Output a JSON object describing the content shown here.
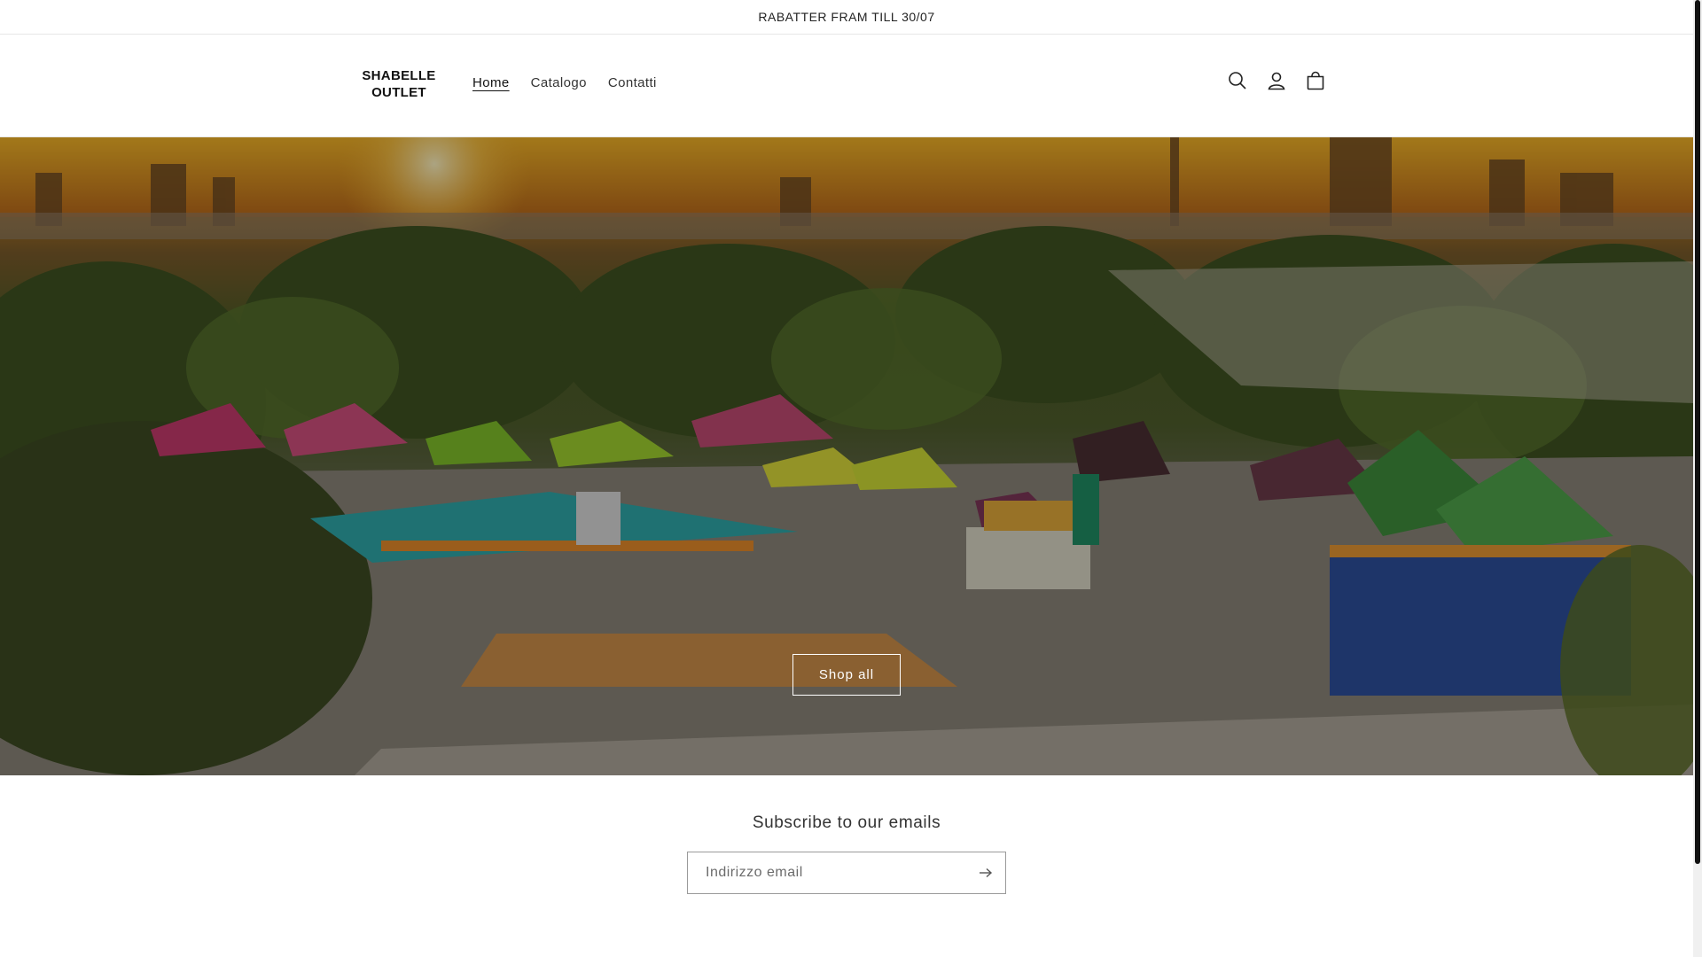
{
  "announcement": {
    "text": "RABATTER FRAM TILL 30/07"
  },
  "header": {
    "logo_line1": "SHABELLE",
    "logo_line2": "OUTLET",
    "nav": [
      {
        "label": "Home",
        "active": true
      },
      {
        "label": "Catalogo",
        "active": false
      },
      {
        "label": "Contatti",
        "active": false
      }
    ],
    "icons": [
      "search-icon",
      "account-icon",
      "cart-icon"
    ]
  },
  "hero": {
    "button_label": "Shop all",
    "overlay_color": "#000000"
  },
  "newsletter": {
    "title": "Subscribe to our emails",
    "email_placeholder": "Indirizzo email",
    "submit_icon": "arrow-right-icon"
  },
  "colors": {
    "accent": "#121212",
    "border": "#e6e6e6",
    "hero_sky": "#e8a526"
  }
}
